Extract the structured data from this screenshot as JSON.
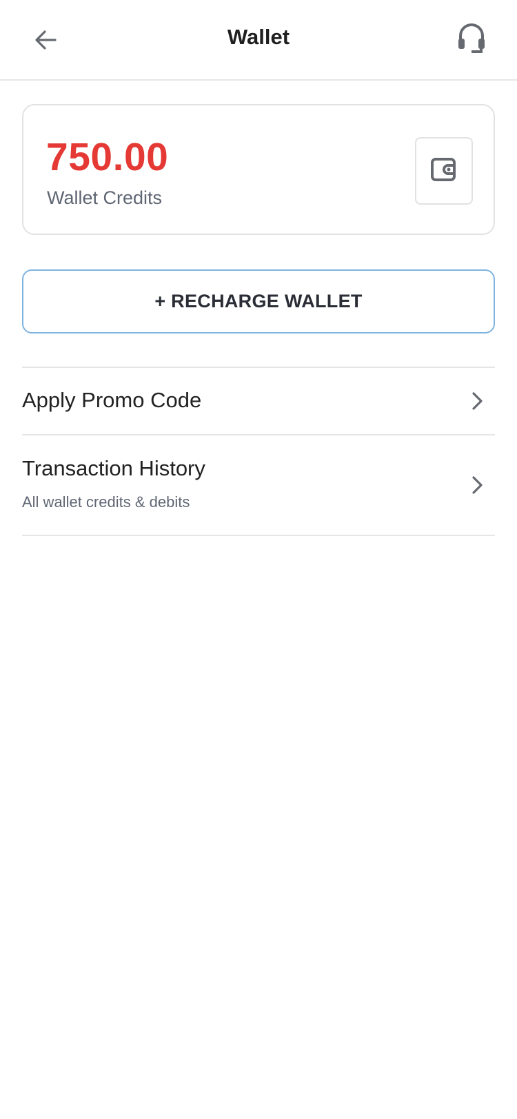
{
  "header": {
    "title": "Wallet",
    "back_icon": "arrow-left-icon",
    "support_icon": "headset-icon"
  },
  "balance": {
    "amount": "750.00",
    "label": "Wallet Credits",
    "icon": "wallet-icon",
    "amount_color": "#e53935"
  },
  "recharge": {
    "label": "+ RECHARGE WALLET",
    "border_color": "#7fb3e0"
  },
  "menu": {
    "items": [
      {
        "title": "Apply Promo Code",
        "subtitle": "",
        "icon": "chevron-right-icon"
      },
      {
        "title": "Transaction History",
        "subtitle": "All wallet credits & debits",
        "icon": "chevron-right-icon"
      }
    ]
  }
}
